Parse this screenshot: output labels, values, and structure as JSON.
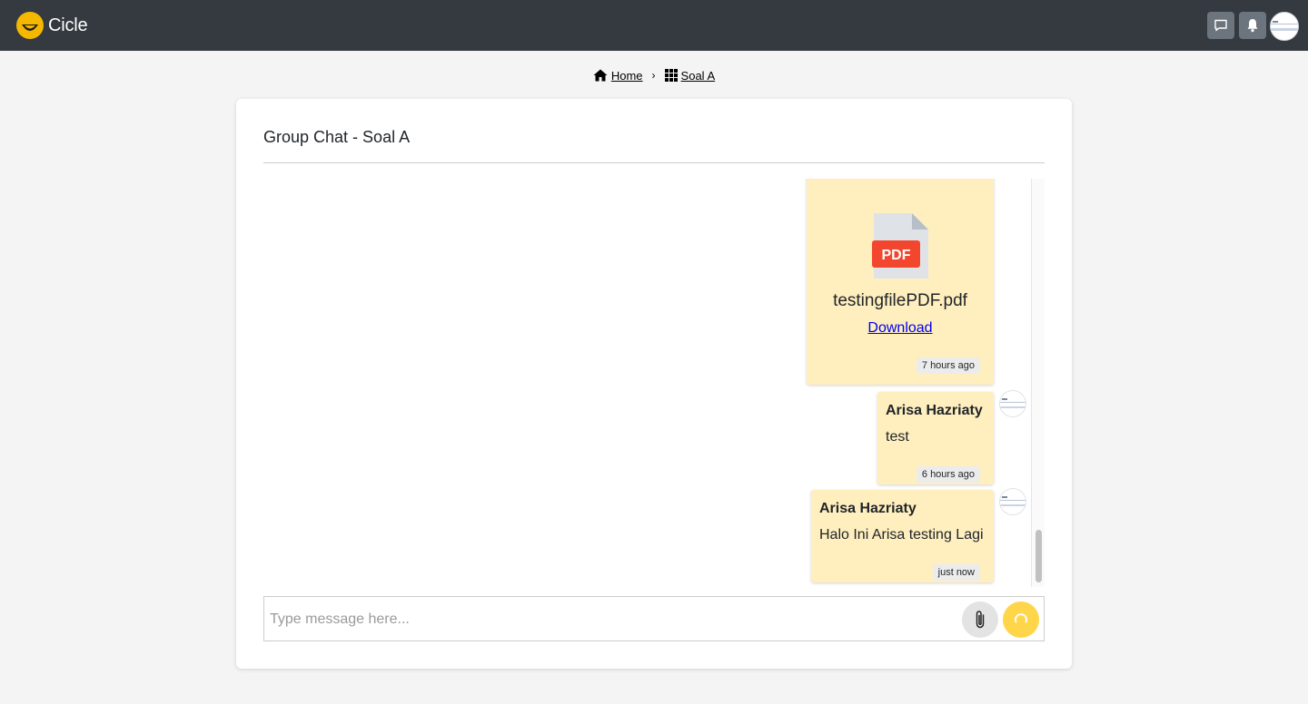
{
  "app": {
    "brand": "Cicle",
    "accent_color": "#ffd54a",
    "topbar_color": "#343a40"
  },
  "topbar": {
    "chat_icon": "chat-bubble-icon",
    "notification_icon": "bell-icon",
    "avatar_icon": "user-avatar"
  },
  "breadcrumb": {
    "home_label": "Home",
    "home_icon": "home-icon",
    "separator": "›",
    "current_label": "Soal A",
    "current_icon": "grid-icon"
  },
  "chat": {
    "title": "Group Chat - Soal A",
    "bubble_color": "#ffefbf",
    "messages": [
      {
        "type": "file",
        "file_name": "testingfilePDF.pdf",
        "file_icon": "pdf-file-icon",
        "file_badge": "PDF",
        "download_label": "Download",
        "time": "7 hours ago"
      },
      {
        "type": "text",
        "sender": "Arisa Hazriaty",
        "text": "test",
        "time": "6 hours ago"
      },
      {
        "type": "text",
        "sender": "Arisa Hazriaty",
        "text": "Halo Ini Arisa testing Lagi",
        "time": "just now"
      }
    ]
  },
  "composer": {
    "placeholder": "Type message here...",
    "value": "",
    "attach_icon": "paperclip-icon",
    "send_icon": "loading-spinner-icon"
  }
}
